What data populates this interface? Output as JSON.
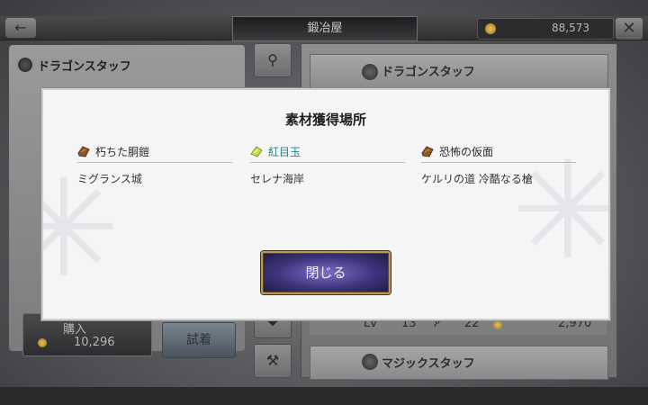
{
  "header": {
    "title": "鍛冶屋",
    "gold": "88,573"
  },
  "left_panel": {
    "item_name": "ドラゴンスタッフ",
    "buy_label": "購入",
    "buy_price": "10,296",
    "try_label": "試着"
  },
  "right_panel": {
    "card1_name": "ドラゴンスタッフ",
    "lv_label": "Lv",
    "lv_value": "13",
    "atk_value": "22",
    "price": "2,970",
    "card2_name": "マジックスタッフ"
  },
  "modal": {
    "title": "素材獲得場所",
    "materials": [
      {
        "name": "朽ちた胴鎧",
        "location": "ミグランス城",
        "icon": "brown-material-icon"
      },
      {
        "name": "紅目玉",
        "location": "セレナ海岸",
        "icon": "yellow-green-material-icon",
        "color": "#2a7f86"
      },
      {
        "name": "恐怖の仮面",
        "location": "ケルリの道 冷酷なる槍",
        "icon": "brown-material-icon"
      }
    ],
    "close_label": "閉じる"
  },
  "colors": {
    "modal_bg": "#f5f5f5",
    "button_purple": "#3e347c",
    "button_border_gold": "#b99a55",
    "highlight_teal": "#2a7f86"
  }
}
